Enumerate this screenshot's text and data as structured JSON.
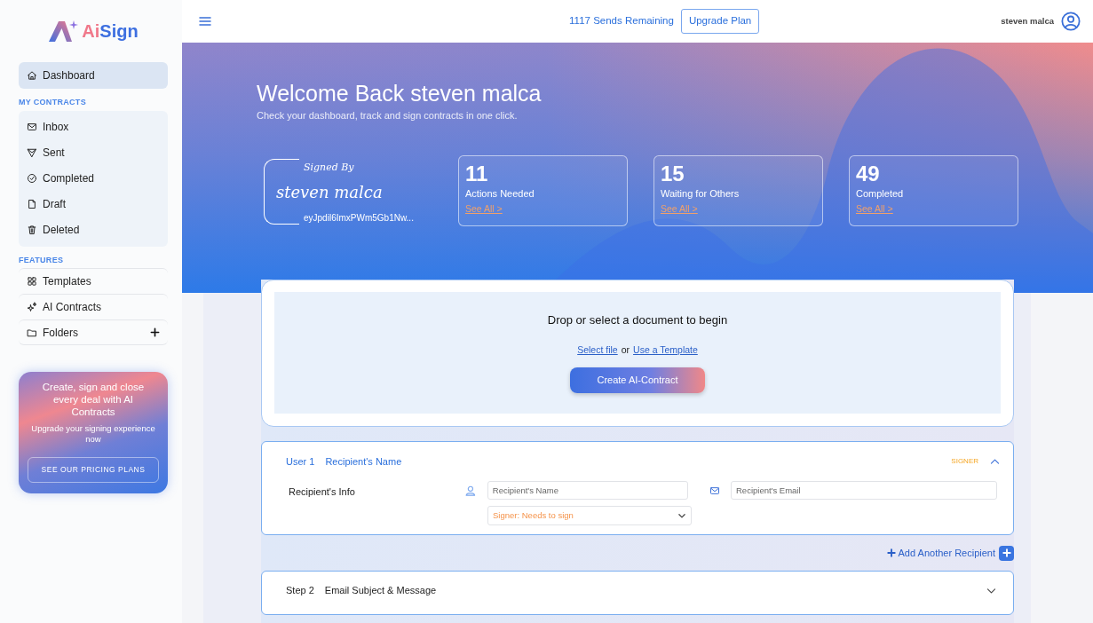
{
  "brand": {
    "parts": [
      {
        "text": "Ai",
        "color": "#f0788a"
      },
      {
        "text": "Sign",
        "color": "#3d6fe0"
      }
    ]
  },
  "sidebar": {
    "dashboard": {
      "label": "Dashboard",
      "selected": true
    },
    "sections": [
      {
        "heading": "MY CONTRACTS",
        "items": [
          {
            "label": "Inbox",
            "selected": false
          },
          {
            "label": "Sent",
            "selected": false
          },
          {
            "label": "Completed",
            "selected": false
          },
          {
            "label": "Draft",
            "selected": false
          },
          {
            "label": "Deleted",
            "selected": false
          }
        ]
      },
      {
        "heading": "FEATURES",
        "items": [
          {
            "label": "Templates",
            "selected": false,
            "addable": false
          },
          {
            "label": "AI Contracts",
            "selected": false,
            "addable": false
          },
          {
            "label": "Folders",
            "selected": false,
            "addable": true
          }
        ]
      }
    ]
  },
  "promo": {
    "title": "Create, sign and close every deal with AI Contracts",
    "text": "Upgrade your signing experience now",
    "button": "SEE OUR PRICING PLANS"
  },
  "header": {
    "sends": "1117 Sends Remaining",
    "upgrade": "Upgrade Plan",
    "user": "steven malca"
  },
  "hero": {
    "title": "Welcome Back steven malca",
    "subtitle": "Check your dashboard, track and sign contracts in one click.",
    "signature": {
      "caption": "Signed By",
      "name": "steven malca",
      "hash": "eyJpdil6ImxPWm5Gb1Nw..."
    },
    "stats": [
      {
        "value": "11",
        "label": "Actions Needed",
        "link": "See All >"
      },
      {
        "value": "15",
        "label": "Waiting for Others",
        "link": "See All >"
      },
      {
        "value": "49",
        "label": "Completed",
        "link": "See All >"
      }
    ]
  },
  "upload": {
    "title": "Drop or select a document to begin",
    "select": "Select file",
    "or": "or",
    "template": "Use a Template",
    "button": "Create AI-Contract"
  },
  "recipients": [
    {
      "step": "User 1",
      "name": "Recipient's Name",
      "role": "SIGNER",
      "expanded": true,
      "info_label": "Recipient's Info",
      "name_placeholder": "Recipient's Name",
      "email_placeholder": "Recipient's Email",
      "signer_type": "Signer: Needs to sign"
    }
  ],
  "add_recipient": "Add Another Recipient",
  "steps": [
    {
      "step": "Step 2",
      "title": "Email Subject & Message",
      "expanded": false
    }
  ]
}
